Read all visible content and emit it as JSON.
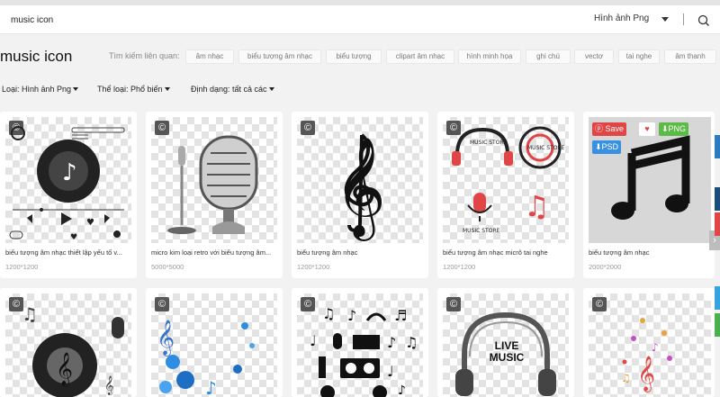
{
  "search": {
    "value": "music icon",
    "type_label": "Hình ảnh Png"
  },
  "page_title": "music icon",
  "related": {
    "label": "Tìm kiếm liên quan:",
    "tags": [
      "âm nhạc",
      "biểu tượng âm nhạc",
      "biểu tượng",
      "clipart âm nhạc",
      "hình minh họa",
      "ghi chú",
      "vectơ",
      "tai nghe",
      "âm thanh"
    ]
  },
  "filters": {
    "type": "Loại:  Hình ảnh Png",
    "category": "Thể loại:  Phổ biến",
    "format": "Định dạng:  tất cả các"
  },
  "cards": [
    {
      "title": "biểu tượng âm nhạc thiết lập yếu tố v...",
      "dims": "1200*1200"
    },
    {
      "title": "micro kim loại retro với biểu tượng âm...",
      "dims": "5000*5000"
    },
    {
      "title": "biểu tượng âm nhạc",
      "dims": "1200*1200"
    },
    {
      "title": "biểu tượng âm nhạc micrô tai nghe",
      "dims": "1200*1200"
    },
    {
      "title": "biểu tượng âm nhạc",
      "dims": "2000*2000"
    },
    {
      "title": "",
      "dims": ""
    },
    {
      "title": "",
      "dims": ""
    },
    {
      "title": "",
      "dims": ""
    },
    {
      "title": "",
      "dims": ""
    },
    {
      "title": "",
      "dims": ""
    }
  ],
  "thumb_texts": {
    "music_store_top": "MUSIC STORE",
    "music_store_right": "MUSIC STORE",
    "music_store_bottom": "MUSIC STORE",
    "live_music": "LIVE MUSIC"
  },
  "hover_actions": {
    "save": "Save",
    "png": "PNG",
    "psd": "PSD"
  },
  "colors": {
    "accent_red": "#e04646",
    "png_green": "#5cba47",
    "psd_blue": "#3a90e0"
  }
}
